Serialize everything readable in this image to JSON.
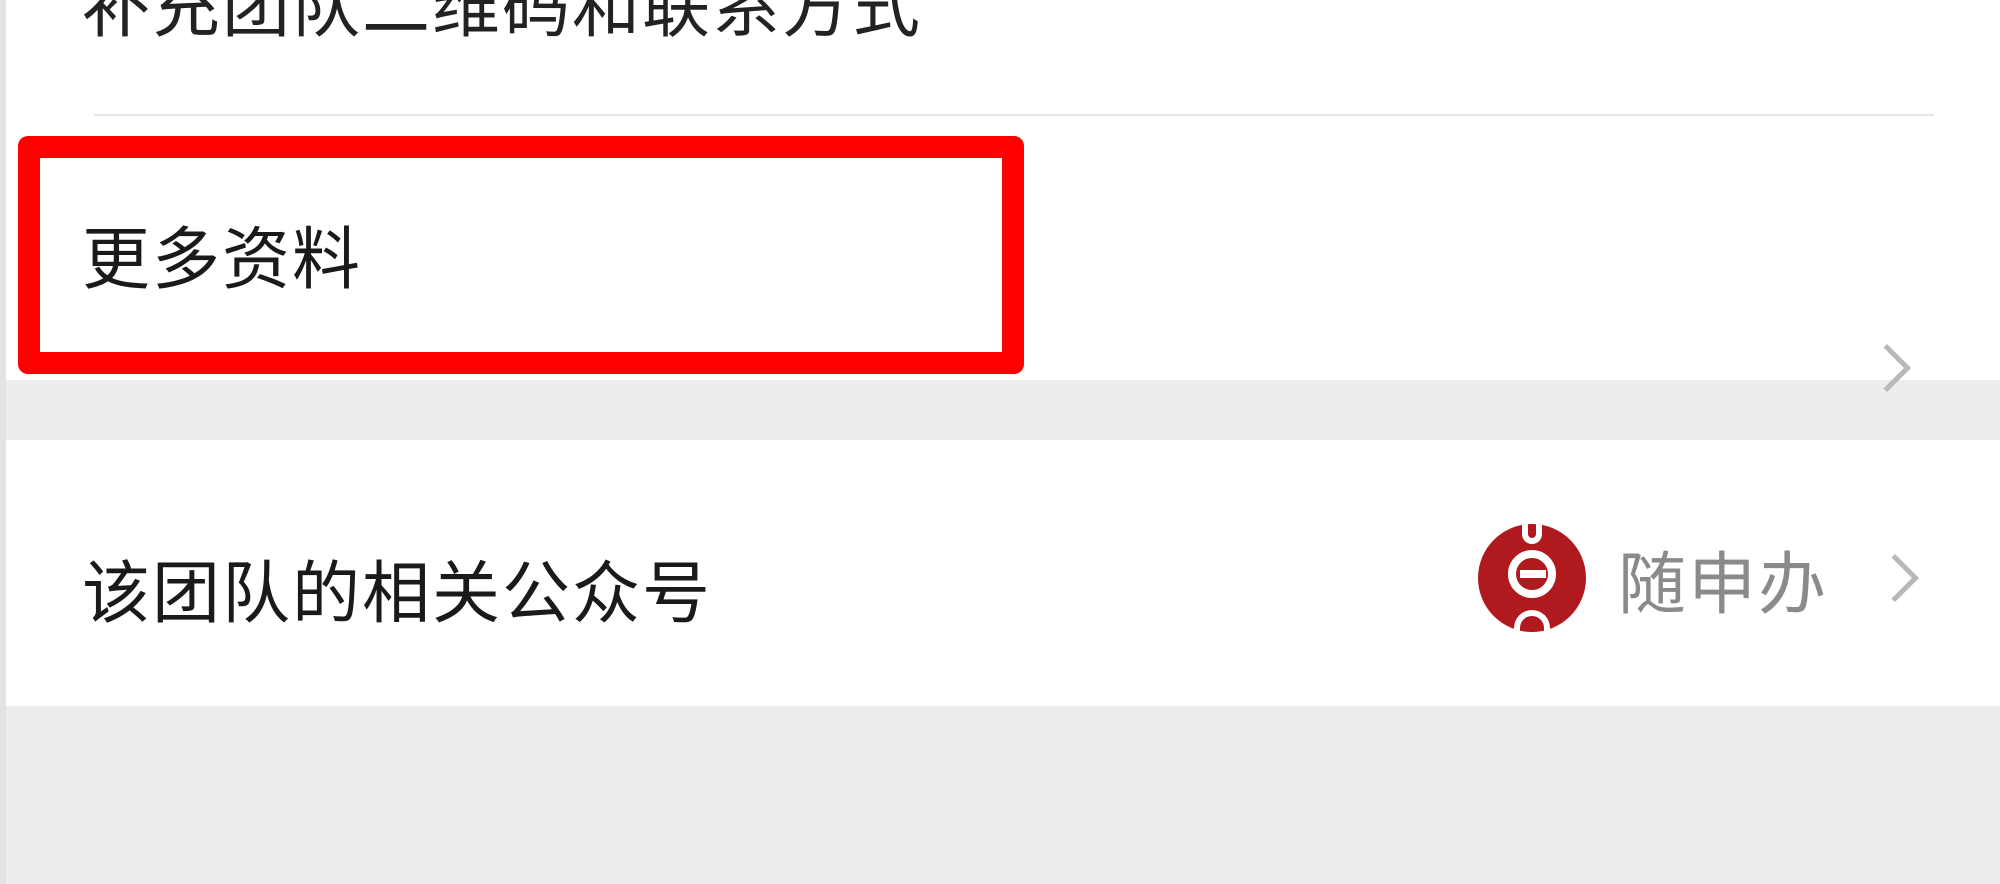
{
  "partial_item": {
    "label": "补充团队二维码和联系方式"
  },
  "more_info": {
    "label": "更多资料"
  },
  "related_accounts": {
    "label": "该团队的相关公众号",
    "account_name": "随申办",
    "account_icon": "gov-service-logo-icon"
  },
  "colors": {
    "highlight": "#ff0000",
    "avatar": "#b0191e",
    "background": "#ededed"
  }
}
